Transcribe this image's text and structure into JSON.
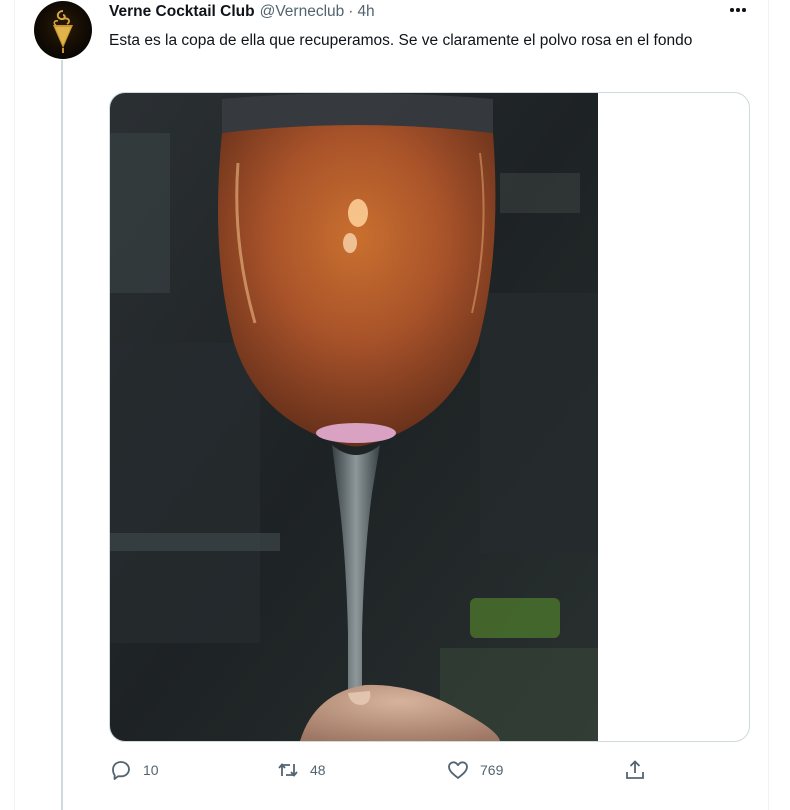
{
  "tweet": {
    "author": {
      "display_name": "Verne Cocktail Club",
      "handle": "@Verneclub",
      "avatar_icon": "verne-cocktail-logo"
    },
    "separator": "·",
    "timestamp": "4h",
    "text": "Esta es la copa de ella que recuperamos. Se ve claramente el polvo rosa en el fondo",
    "media": {
      "type": "photo",
      "subject": "champagne-flute-with-pink-sediment"
    },
    "actions": {
      "reply": {
        "icon": "reply-icon",
        "count": "10"
      },
      "retweet": {
        "icon": "retweet-icon",
        "count": "48"
      },
      "like": {
        "icon": "heart-icon",
        "count": "769"
      },
      "share": {
        "icon": "share-icon"
      }
    }
  },
  "colors": {
    "text_primary": "#0f1419",
    "text_secondary": "#536471",
    "border": "#cfd9de",
    "thread_line": "#cfd9de"
  }
}
